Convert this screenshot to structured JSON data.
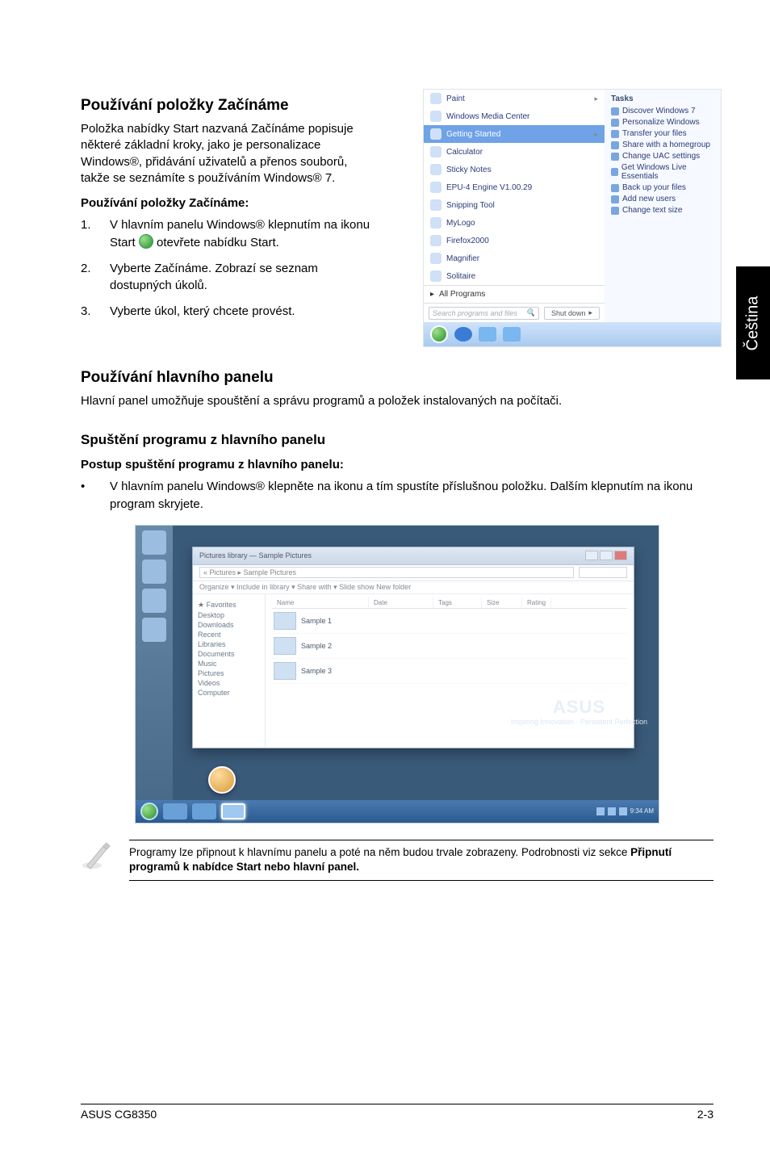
{
  "sidetab": "Čeština",
  "s1": {
    "h": "Používání položky Začínáme",
    "p": "Položka nabídky Start nazvaná Začínáme popisuje některé základní kroky, jako je personalizace Windows®, přidávání uživatelů a přenos souborů, takže se seznámíte s používáním Windows® 7.",
    "sub": "Používání položky Začínáme:",
    "steps": {
      "n1": "1.",
      "t1a": "V hlavním panelu Windows® klepnutím na ikonu Start ",
      "t1b": " otevřete nabídku Start.",
      "n2": "2.",
      "t2": "Vyberte Začínáme. Zobrazí se seznam dostupných úkolů.",
      "n3": "3.",
      "t3": "Vyberte úkol, který chcete provést."
    }
  },
  "startmenu": {
    "items": [
      "Paint",
      "Windows Media Center",
      "Getting Started",
      "Calculator",
      "Sticky Notes",
      "EPU-4 Engine V1.00.29",
      "Snipping Tool",
      "MyLogo",
      "Firefox2000",
      "Magnifier",
      "Solitaire"
    ],
    "allprograms": "All Programs",
    "search": "Search programs and files",
    "shut": "Shut down",
    "tasks_h": "Tasks",
    "tasks": [
      "Discover Windows 7",
      "Personalize Windows",
      "Transfer your files",
      "Share with a homegroup",
      "Change UAC settings",
      "Get Windows Live Essentials",
      "Back up your files",
      "Add new users",
      "Change text size"
    ]
  },
  "s2": {
    "h": "Používání hlavního panelu",
    "p": "Hlavní panel umožňuje spouštění a správu programů a položek instalovaných na počítači."
  },
  "s3": {
    "h": "Spuštění programu z hlavního panelu",
    "sub": "Postup spuštění programu z hlavního panelu:",
    "bul": "V hlavním panelu Windows® klepněte na ikonu a tím spustíte příslušnou položku. Dalším klepnutím na ikonu program skryjete.",
    "dot": "•"
  },
  "explorer": {
    "title": "Pictures library — Sample Pictures",
    "addr": "« Pictures ▸ Sample Pictures",
    "menu": "Organize ▾    Include in library ▾    Share with ▾    Slide show    New folder",
    "nav": [
      "★ Favorites",
      " Desktop",
      " Downloads",
      " Recent",
      " ",
      " Libraries",
      " Documents",
      " Music",
      " Pictures",
      " Videos",
      " ",
      " Computer"
    ],
    "cols": [
      "Name",
      "Date",
      "Tags",
      "Size",
      "Rating"
    ],
    "rows": [
      "Sample 1",
      "Sample 2",
      "Sample 3"
    ],
    "asus_logo": "ASUS",
    "asus_tag": "Inspiring Innovation · Persistent Perfection",
    "clock": "9:34 AM"
  },
  "note": {
    "l1": "Programy lze připnout k hlavnímu panelu a poté na něm budou trvale zobrazeny. Podrobnosti viz sekce ",
    "l2": "Připnutí programů k nabídce Start nebo hlavní panel."
  },
  "footer": {
    "left": "ASUS CG8350",
    "right": "2-3"
  }
}
